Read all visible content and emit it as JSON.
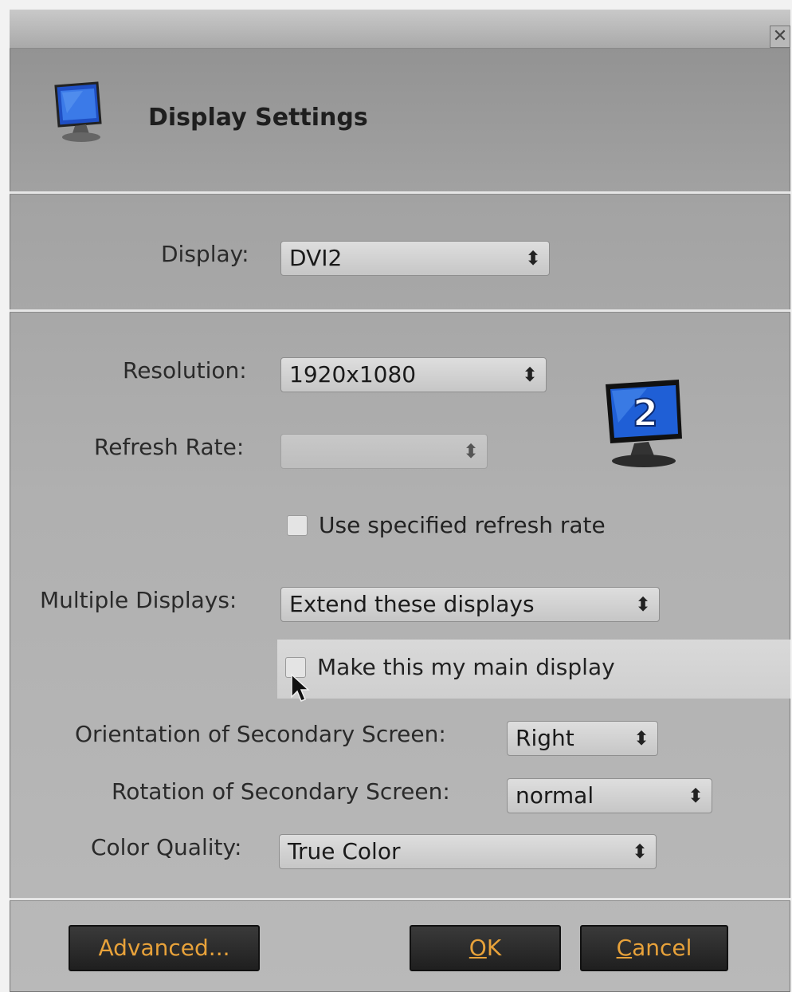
{
  "header": {
    "title": "Display Settings"
  },
  "display": {
    "label": "Display:",
    "value": "DVI2"
  },
  "resolution": {
    "label": "Resolution:",
    "value": "1920x1080"
  },
  "refresh_rate": {
    "label": "Refresh Rate:",
    "value": "",
    "enabled": false
  },
  "use_refresh": {
    "label": "Use specified refresh rate",
    "checked": false
  },
  "multiple_displays": {
    "label": "Multiple Displays:",
    "value": "Extend these displays"
  },
  "main_display": {
    "label": "Make this my main display",
    "checked": false
  },
  "orientation": {
    "label": "Orientation of Secondary Screen:",
    "value": "Right"
  },
  "rotation": {
    "label": "Rotation of Secondary Screen:",
    "value": "normal"
  },
  "color_quality": {
    "label": "Color Quality:",
    "value": "True Color"
  },
  "monitor_badge": "2",
  "buttons": {
    "advanced": "Advanced...",
    "ok_mnemonic": "O",
    "ok_rest": "K",
    "cancel_mnemonic": "C",
    "cancel_rest": "ancel"
  },
  "colors": {
    "button_text": "#e8a23a",
    "monitor_blue": "#1f5fd6"
  }
}
